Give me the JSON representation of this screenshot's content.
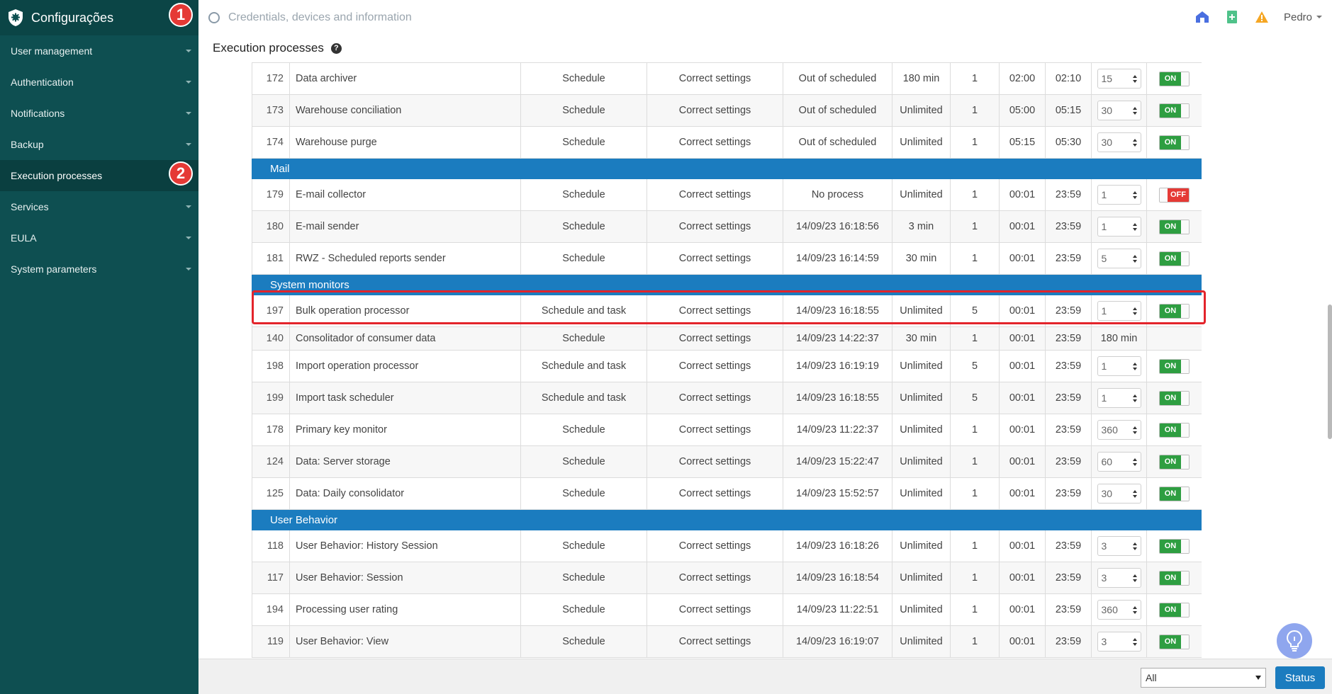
{
  "app": {
    "title": "Configurações"
  },
  "markers": [
    "1",
    "2"
  ],
  "sidebar": {
    "items": [
      {
        "label": "User management",
        "active": false,
        "has_caret": true
      },
      {
        "label": "Authentication",
        "active": false,
        "has_caret": true
      },
      {
        "label": "Notifications",
        "active": false,
        "has_caret": true
      },
      {
        "label": "Backup",
        "active": false,
        "has_caret": true
      },
      {
        "label": "Execution processes",
        "active": true,
        "has_caret": false
      },
      {
        "label": "Services",
        "active": false,
        "has_caret": true
      },
      {
        "label": "EULA",
        "active": false,
        "has_caret": true
      },
      {
        "label": "System parameters",
        "active": false,
        "has_caret": true
      }
    ]
  },
  "search": {
    "placeholder": "Credentials, devices and information"
  },
  "user": {
    "name": "Pedro"
  },
  "page": {
    "title": "Execution processes"
  },
  "table": {
    "rows": [
      {
        "type": "row",
        "id": "172",
        "name": "Data archiver",
        "mode": "Schedule",
        "status": "Correct settings",
        "last": "Out of scheduled",
        "timeout": "180 min",
        "threads": "1",
        "start": "02:00",
        "end": "02:10",
        "interval": "15",
        "toggle": "ON"
      },
      {
        "type": "row",
        "id": "173",
        "name": "Warehouse conciliation",
        "mode": "Schedule",
        "status": "Correct settings",
        "last": "Out of scheduled",
        "timeout": "Unlimited",
        "threads": "1",
        "start": "05:00",
        "end": "05:15",
        "interval": "30",
        "toggle": "ON"
      },
      {
        "type": "row",
        "id": "174",
        "name": "Warehouse purge",
        "mode": "Schedule",
        "status": "Correct settings",
        "last": "Out of scheduled",
        "timeout": "Unlimited",
        "threads": "1",
        "start": "05:15",
        "end": "05:30",
        "interval": "30",
        "toggle": "ON"
      },
      {
        "type": "group",
        "label": "Mail"
      },
      {
        "type": "row",
        "id": "179",
        "name": "E-mail collector",
        "mode": "Schedule",
        "status": "Correct settings",
        "last": "No process",
        "timeout": "Unlimited",
        "threads": "1",
        "start": "00:01",
        "end": "23:59",
        "interval": "1",
        "toggle": "OFF"
      },
      {
        "type": "row",
        "id": "180",
        "name": "E-mail sender",
        "mode": "Schedule",
        "status": "Correct settings",
        "last": "14/09/23 16:18:56",
        "timeout": "3 min",
        "threads": "1",
        "start": "00:01",
        "end": "23:59",
        "interval": "1",
        "toggle": "ON"
      },
      {
        "type": "row",
        "id": "181",
        "name": "RWZ - Scheduled reports sender",
        "mode": "Schedule",
        "status": "Correct settings",
        "last": "14/09/23 16:14:59",
        "timeout": "30 min",
        "threads": "1",
        "start": "00:01",
        "end": "23:59",
        "interval": "5",
        "toggle": "ON"
      },
      {
        "type": "group",
        "label": "System monitors"
      },
      {
        "type": "row",
        "id": "197",
        "name": "Bulk operation processor",
        "mode": "Schedule and task",
        "status": "Correct settings",
        "last": "14/09/23 16:18:55",
        "timeout": "Unlimited",
        "threads": "5",
        "start": "00:01",
        "end": "23:59",
        "interval": "1",
        "toggle": "ON",
        "highlight": true
      },
      {
        "type": "row",
        "id": "140",
        "name": "Consolitador of consumer data",
        "mode": "Schedule",
        "status": "Correct settings",
        "last": "14/09/23 14:22:37",
        "timeout": "30 min",
        "threads": "1",
        "start": "00:01",
        "end": "23:59",
        "interval_text": "180 min",
        "toggle": "",
        "short": true
      },
      {
        "type": "row",
        "id": "198",
        "name": "Import operation processor",
        "mode": "Schedule and task",
        "status": "Correct settings",
        "last": "14/09/23 16:19:19",
        "timeout": "Unlimited",
        "threads": "5",
        "start": "00:01",
        "end": "23:59",
        "interval": "1",
        "toggle": "ON"
      },
      {
        "type": "row",
        "id": "199",
        "name": "Import task scheduler",
        "mode": "Schedule and task",
        "status": "Correct settings",
        "last": "14/09/23 16:18:55",
        "timeout": "Unlimited",
        "threads": "5",
        "start": "00:01",
        "end": "23:59",
        "interval": "1",
        "toggle": "ON"
      },
      {
        "type": "row",
        "id": "178",
        "name": "Primary key monitor",
        "mode": "Schedule",
        "status": "Correct settings",
        "last": "14/09/23 11:22:37",
        "timeout": "Unlimited",
        "threads": "1",
        "start": "00:01",
        "end": "23:59",
        "interval": "360",
        "toggle": "ON"
      },
      {
        "type": "row",
        "id": "124",
        "name": "Data: Server storage",
        "mode": "Schedule",
        "status": "Correct settings",
        "last": "14/09/23 15:22:47",
        "timeout": "Unlimited",
        "threads": "1",
        "start": "00:01",
        "end": "23:59",
        "interval": "60",
        "toggle": "ON"
      },
      {
        "type": "row",
        "id": "125",
        "name": "Data: Daily consolidator",
        "mode": "Schedule",
        "status": "Correct settings",
        "last": "14/09/23 15:52:57",
        "timeout": "Unlimited",
        "threads": "1",
        "start": "00:01",
        "end": "23:59",
        "interval": "30",
        "toggle": "ON"
      },
      {
        "type": "group",
        "label": "User Behavior"
      },
      {
        "type": "row",
        "id": "118",
        "name": "User Behavior: History Session",
        "mode": "Schedule",
        "status": "Correct settings",
        "last": "14/09/23 16:18:26",
        "timeout": "Unlimited",
        "threads": "1",
        "start": "00:01",
        "end": "23:59",
        "interval": "3",
        "toggle": "ON"
      },
      {
        "type": "row",
        "id": "117",
        "name": "User Behavior: Session",
        "mode": "Schedule",
        "status": "Correct settings",
        "last": "14/09/23 16:18:54",
        "timeout": "Unlimited",
        "threads": "1",
        "start": "00:01",
        "end": "23:59",
        "interval": "3",
        "toggle": "ON"
      },
      {
        "type": "row",
        "id": "194",
        "name": "Processing user rating",
        "mode": "Schedule",
        "status": "Correct settings",
        "last": "14/09/23 11:22:51",
        "timeout": "Unlimited",
        "threads": "1",
        "start": "00:01",
        "end": "23:59",
        "interval": "360",
        "toggle": "ON"
      },
      {
        "type": "row",
        "id": "119",
        "name": "User Behavior: View",
        "mode": "Schedule",
        "status": "Correct settings",
        "last": "14/09/23 16:19:07",
        "timeout": "Unlimited",
        "threads": "1",
        "start": "00:01",
        "end": "23:59",
        "interval": "3",
        "toggle": "ON"
      }
    ]
  },
  "footer": {
    "filter_value": "All",
    "status_button": "Status"
  },
  "colors": {
    "sidebar": "#0e4f51",
    "group_header": "#1b7cbf",
    "toggle_on": "#2e9e41",
    "toggle_off": "#e53935",
    "highlight": "#e3242b"
  }
}
